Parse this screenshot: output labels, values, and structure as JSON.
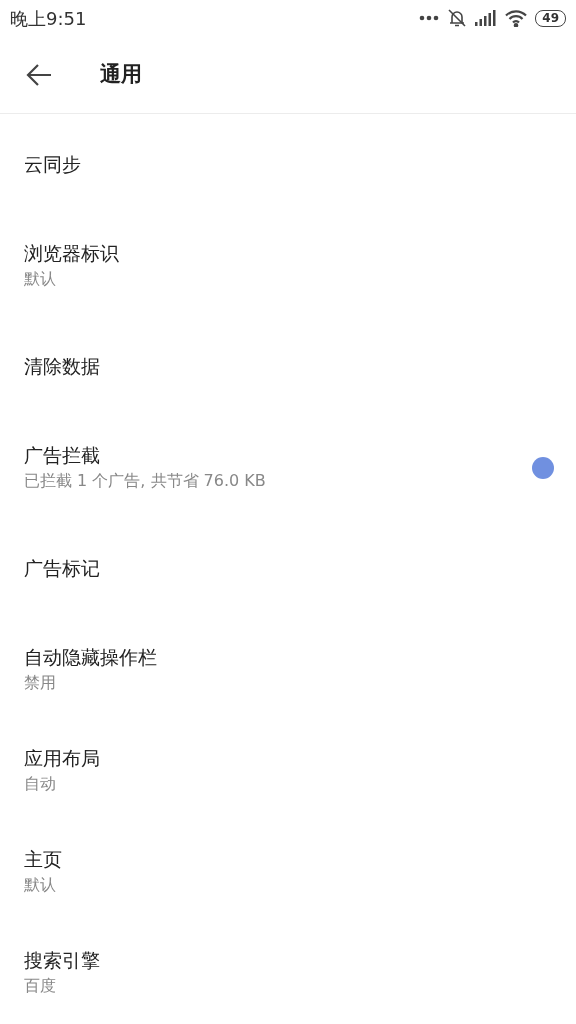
{
  "status_bar": {
    "time": "晚上9:51",
    "battery": "49"
  },
  "header": {
    "title": "通用"
  },
  "items": [
    {
      "title": "云同步",
      "indicator": false
    },
    {
      "title": "浏览器标识",
      "subtitle": "默认",
      "indicator": false
    },
    {
      "title": "清除数据",
      "indicator": false
    },
    {
      "title": "广告拦截",
      "subtitle": "已拦截 1 个广告, 共节省 76.0 KB",
      "indicator": true
    },
    {
      "title": "广告标记",
      "indicator": false
    },
    {
      "title": "自动隐藏操作栏",
      "subtitle": "禁用",
      "indicator": false
    },
    {
      "title": "应用布局",
      "subtitle": "自动",
      "indicator": false
    },
    {
      "title": "主页",
      "subtitle": "默认",
      "indicator": false
    },
    {
      "title": "搜索引擎",
      "subtitle": "百度",
      "indicator": false
    }
  ]
}
